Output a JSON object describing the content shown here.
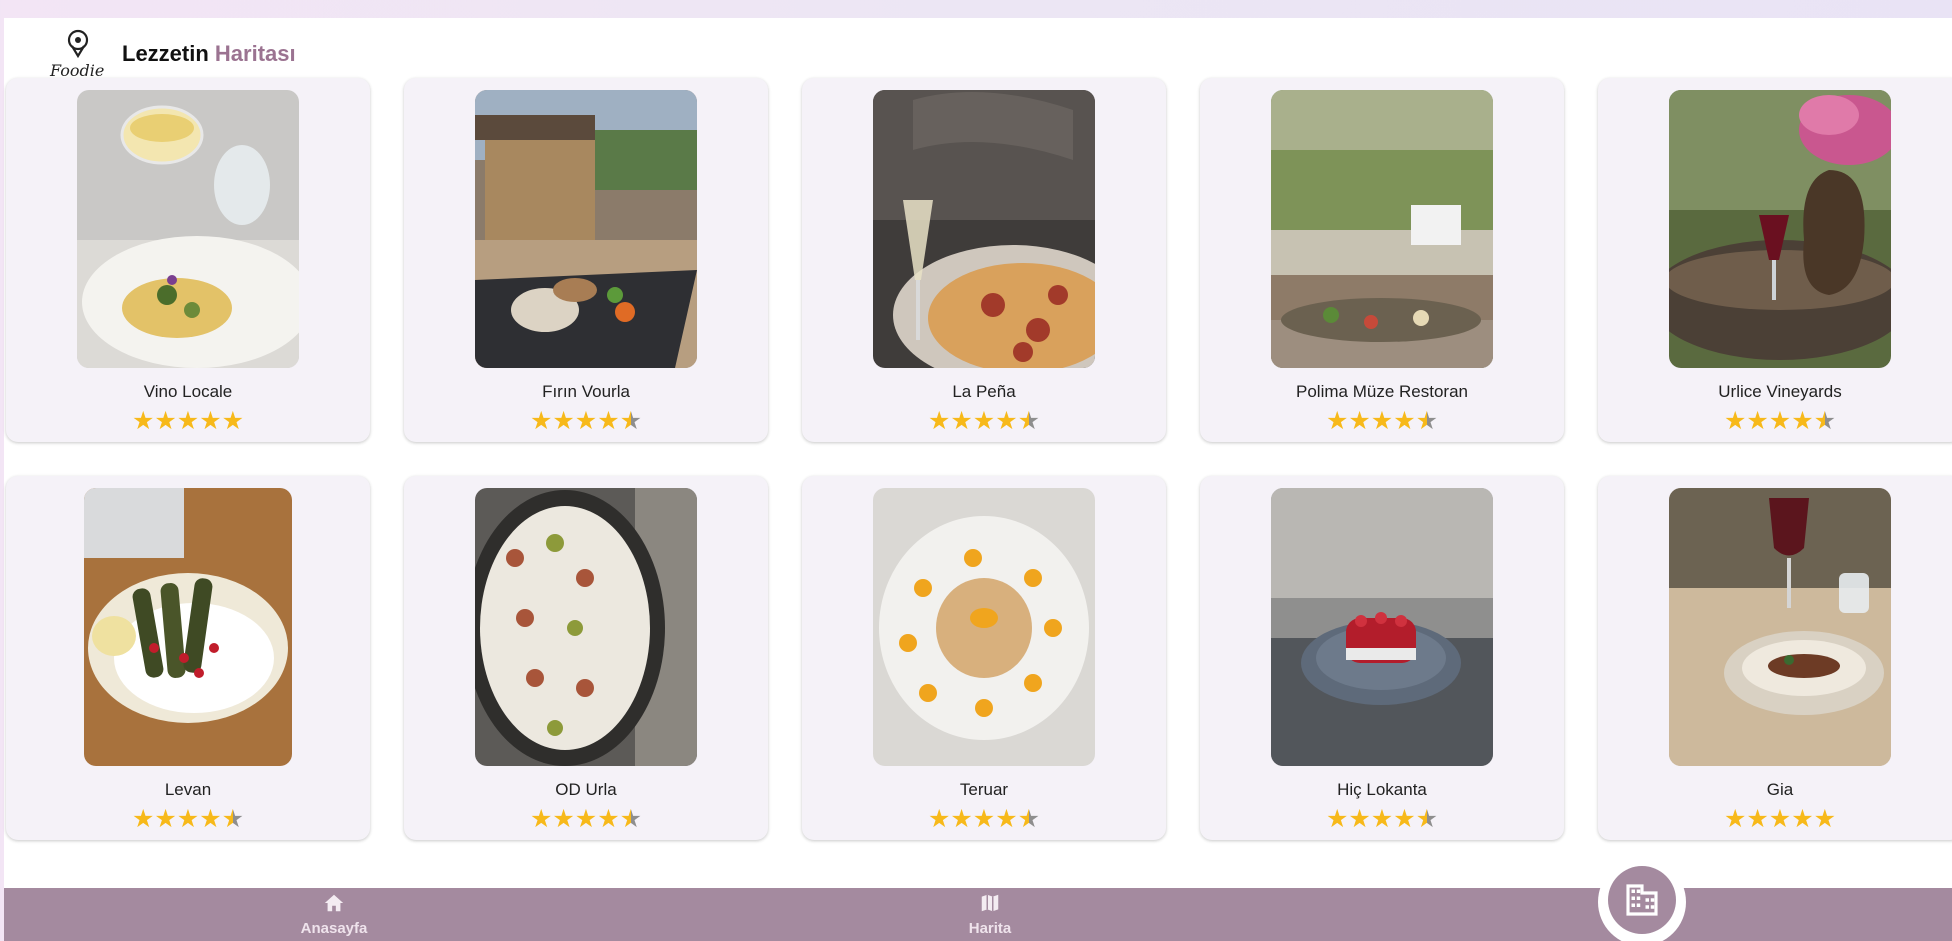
{
  "app": {
    "title_main": "Lezzetin",
    "title_accent": "Haritası",
    "logo_text": "Foodie"
  },
  "restaurants": [
    {
      "name": "Vino Locale",
      "rating": 5
    },
    {
      "name": "Fırın Vourla",
      "rating": 4.5
    },
    {
      "name": "La Peña",
      "rating": 4.5
    },
    {
      "name": "Polima Müze Restoran",
      "rating": 4.5
    },
    {
      "name": "Urlice Vineyards",
      "rating": 4.5
    },
    {
      "name": "Levan",
      "rating": 4.5
    },
    {
      "name": "OD Urla",
      "rating": 4.5
    },
    {
      "name": "Teruar",
      "rating": 4.5
    },
    {
      "name": "Hiç Lokanta",
      "rating": 4.5
    },
    {
      "name": "Gia",
      "rating": 5
    }
  ],
  "nav": {
    "home_label": "Anasayfa",
    "map_label": "Harita",
    "home_icon": "home-icon",
    "map_icon": "map-icon",
    "fab_icon": "building-icon"
  },
  "colors": {
    "accent": "#9b7391",
    "nav_bg": "#a48a9f",
    "star": "#f7b91a",
    "card_bg": "#f5f2f8"
  }
}
